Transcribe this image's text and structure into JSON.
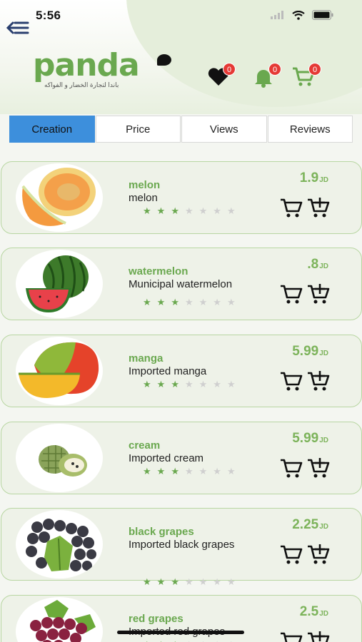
{
  "status_bar": {
    "time": "5:56"
  },
  "header": {
    "logo_text": "panda",
    "logo_tagline": "باندا لتجارة الخضار و الفواكه",
    "favorites_count": "0",
    "notifications_count": "0",
    "cart_count": "0"
  },
  "sort_tabs": [
    {
      "label": "Creation",
      "active": true
    },
    {
      "label": "Price",
      "active": false
    },
    {
      "label": "Views",
      "active": false
    },
    {
      "label": "Reviews",
      "active": false
    }
  ],
  "products": [
    {
      "name": "melon",
      "description": "melon",
      "price": "1.9",
      "currency": "JD",
      "rating": 3,
      "image": "melon-image"
    },
    {
      "name": "watermelon",
      "description": "Municipal watermelon",
      "price": ".8",
      "currency": "JD",
      "rating": 3,
      "image": "watermelon-image"
    },
    {
      "name": "manga",
      "description": "Imported manga",
      "price": "5.99",
      "currency": "JD",
      "rating": 3,
      "image": "mango-image"
    },
    {
      "name": "cream",
      "description": "Imported cream",
      "price": "5.99",
      "currency": "JD",
      "rating": 3,
      "image": "custard-apple-image"
    },
    {
      "name": "black grapes",
      "description": "Imported black grapes",
      "price": "2.25",
      "currency": "JD",
      "rating": 3,
      "image": "black-grapes-image"
    },
    {
      "name": "red grapes",
      "description": "Imported red grapes",
      "price": "2.5",
      "currency": "JD",
      "rating": 3,
      "image": "red-grapes-image"
    }
  ],
  "colors": {
    "brand_green": "#6aa84f",
    "active_tab": "#3d8fdc",
    "badge_red": "#e53935"
  }
}
